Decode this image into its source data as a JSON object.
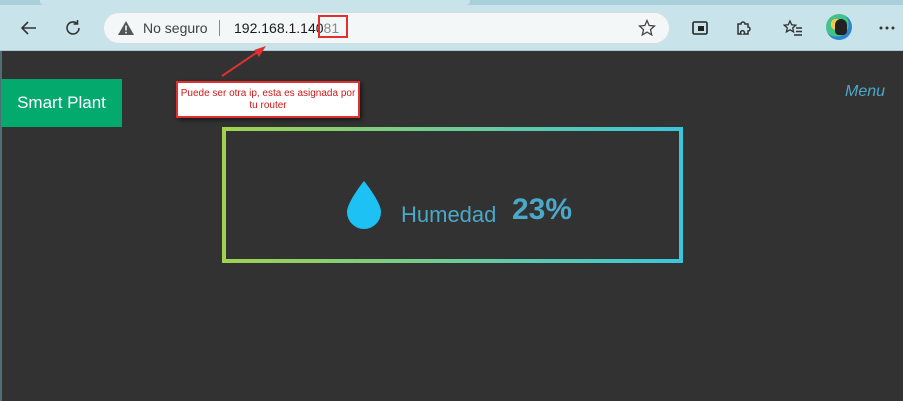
{
  "browser": {
    "security_label": "No seguro",
    "url_host": "192.168.1.140",
    "url_port": "81",
    "icons": [
      "back-icon",
      "refresh-icon",
      "warning-icon",
      "star-icon",
      "picture-in-picture-icon",
      "extensions-icon",
      "favorites-icon",
      "avatar",
      "more-icon"
    ]
  },
  "annotation": {
    "callout_text": "Puede ser otra ip, esta es asignada por tu router",
    "color": "#e03030"
  },
  "page": {
    "brand_label": "Smart Plant",
    "brand_color": "#04aa6d",
    "menu_label": "Menu",
    "accent_color": "#4aa8c8",
    "background_color": "#323232"
  },
  "humidity": {
    "label": "Humedad",
    "value": "23%",
    "icon": "water-drop-icon",
    "border_gradient": [
      "#a0d24e",
      "#3ac6dd"
    ]
  }
}
